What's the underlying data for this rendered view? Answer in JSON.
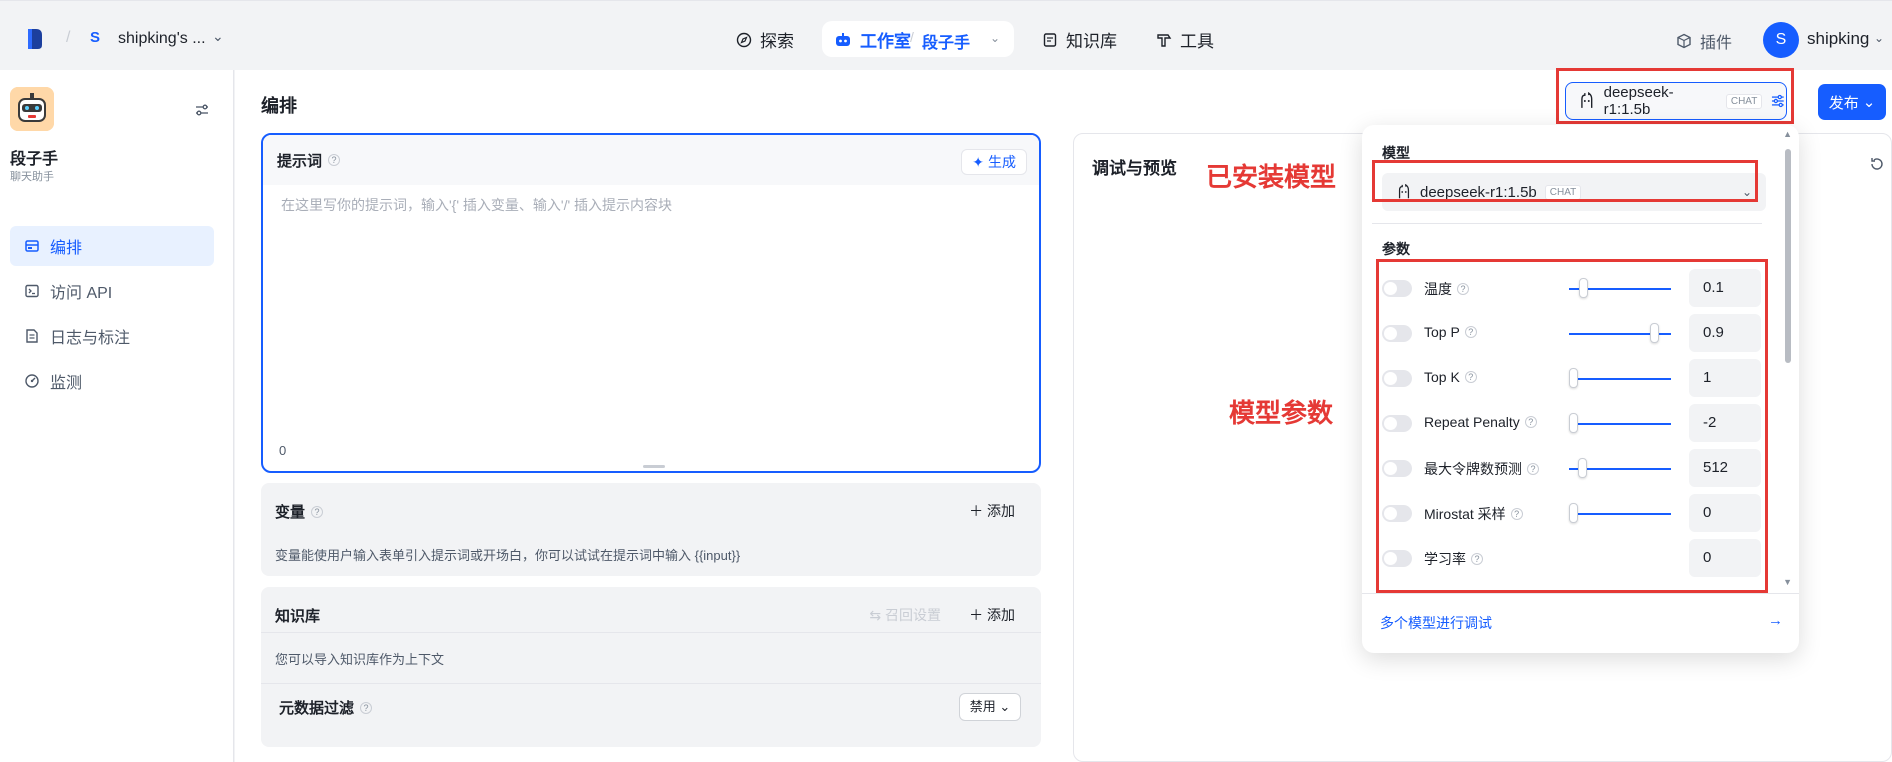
{
  "topbar": {
    "workspace_badge": "S",
    "workspace_name": "shipking's ...",
    "nav_explore": "探索",
    "nav_studio": "工作室",
    "nav_studio_sub": "段子手",
    "nav_knowledge": "知识库",
    "nav_tools": "工具",
    "plugins": "插件",
    "user_initial": "S",
    "user_name": "shipking"
  },
  "sidebar": {
    "app_title": "段子手",
    "app_subtitle": "聊天助手",
    "items": [
      {
        "label": "编排"
      },
      {
        "label": "访问 API"
      },
      {
        "label": "日志与标注"
      },
      {
        "label": "监测"
      }
    ]
  },
  "main": {
    "title": "编排",
    "prompt": {
      "label": "提示词",
      "generate_label": "生成",
      "placeholder": "在这里写你的提示词，输入'{' 插入变量、输入'/' 插入提示内容块",
      "char_count": "0"
    },
    "variables": {
      "title": "变量",
      "add_label": "添加",
      "description": "变量能使用户输入表单引入提示词或开场白，你可以试试在提示词中输入 {{input}}"
    },
    "knowledge": {
      "title": "知识库",
      "recall_label": "召回设置",
      "add_label": "添加",
      "description": "您可以导入知识库作为上下文",
      "metadata_filter": "元数据过滤",
      "disabled_label": "禁用"
    },
    "debug": {
      "title": "调试与预览"
    }
  },
  "model_selector": {
    "model_name": "deepseek-r1:1.5b",
    "tag": "CHAT",
    "publish_label": "发布"
  },
  "popover": {
    "model_label": "模型",
    "model_name": "deepseek-r1:1.5b",
    "tag": "CHAT",
    "params_label": "参数",
    "params": [
      {
        "name": "温度",
        "value": "0.1",
        "has_slider": true
      },
      {
        "name": "Top P",
        "value": "0.9",
        "has_slider": true
      },
      {
        "name": "Top K",
        "value": "1",
        "has_slider": true
      },
      {
        "name": "Repeat Penalty",
        "value": "-2",
        "has_slider": true
      },
      {
        "name": "最大令牌数预测",
        "value": "512",
        "has_slider": true
      },
      {
        "name": "Mirostat 采样",
        "value": "0",
        "has_slider": true
      },
      {
        "name": "学习率",
        "value": "0",
        "has_slider": false
      }
    ],
    "multi_model_label": "多个模型进行调试"
  },
  "annotations": {
    "installed_models": "已安装模型",
    "model_params": "模型参数"
  },
  "colors": {
    "accent": "#165dff",
    "annotation_red": "#e53935"
  }
}
